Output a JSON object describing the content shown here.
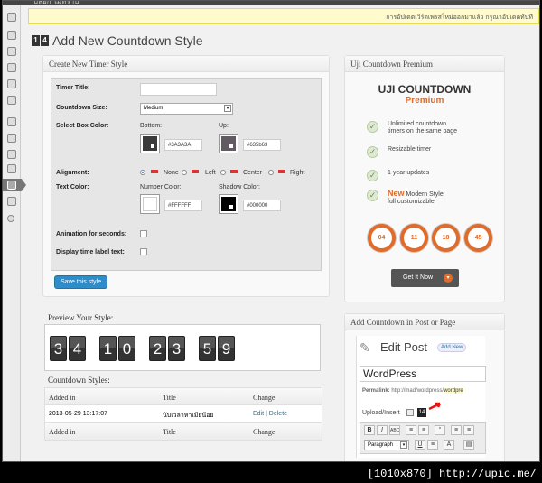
{
  "adminbar": {
    "site": "บล็อก ไม่ทราบ"
  },
  "notice": {
    "text": "การอัปเดตเวิร์ดเพรสใหม่ออกมาแล้ว กรุณาอัปเดตทันที"
  },
  "page": {
    "title": "Add New Countdown Style",
    "icon_digits": [
      "1",
      "4"
    ]
  },
  "timer_panel": {
    "heading": "Create New Timer Style",
    "timer_title_label": "Timer Title:",
    "timer_title_value": "",
    "size_label": "Countdown Size:",
    "size_value": "Medium",
    "box_color_label": "Select Box Color:",
    "bottom_label": "Bottom:",
    "bottom_value": "#3A3A3A",
    "up_label": "Up:",
    "up_value": "#635b63",
    "alignment_label": "Alignment:",
    "align_options": [
      "None",
      "Left",
      "Center",
      "Right"
    ],
    "align_selected": "None",
    "text_color_label": "Text Color:",
    "number_color_label": "Number Color:",
    "number_color_value": "#FFFFFF",
    "shadow_color_label": "Shadow Color:",
    "shadow_color_value": "#000000",
    "animation_label": "Animation for seconds:",
    "time_label_label": "Display time label text:",
    "save_button": "Save this style"
  },
  "preview": {
    "heading": "Preview Your Style:",
    "digits": [
      "3",
      "4",
      "1",
      "0",
      "2",
      "3",
      "5",
      "9"
    ]
  },
  "styles_table": {
    "heading": "Countdown Styles:",
    "columns": [
      "Added in",
      "Title",
      "Change"
    ],
    "rows": [
      {
        "added": "2013-05-29 13:17:07",
        "title": "นับเวลาหาเมียน้อย",
        "edit": "Edit",
        "sep": "|",
        "delete": "Delete"
      }
    ],
    "footer": [
      "Added in",
      "Title",
      "Change"
    ]
  },
  "premium": {
    "heading": "Uji Countdown Premium",
    "title": "UJI COUNTDOWN",
    "subtitle": "Premium",
    "features": [
      {
        "line1": "Unlimited countdown",
        "line2": "timers on the same page"
      },
      {
        "line1": "Resizable timer",
        "line2": ""
      },
      {
        "line1": "1 year updates",
        "line2": ""
      },
      {
        "new": "New",
        "line1": "Modern Style",
        "line2": "full customizable"
      }
    ],
    "rings": [
      "04",
      "11",
      "18",
      "45"
    ],
    "button": "Get It Now"
  },
  "add_post": {
    "heading": "Add Countdown in Post or Page",
    "edit_post": "Edit Post",
    "add_new": "Add New",
    "post_title": "WordPress",
    "permalink_label": "Permalink:",
    "permalink_url": "http://mad/wordpress/",
    "permalink_slug": "wordpre",
    "upload_label": "Upload/Insert",
    "paragraph": "Paragraph"
  },
  "watermark": "[1010x870] http://upic.me/",
  "colors": {
    "accent": "#e06b2a",
    "link": "#21759b",
    "button": "#2e8cc9"
  }
}
